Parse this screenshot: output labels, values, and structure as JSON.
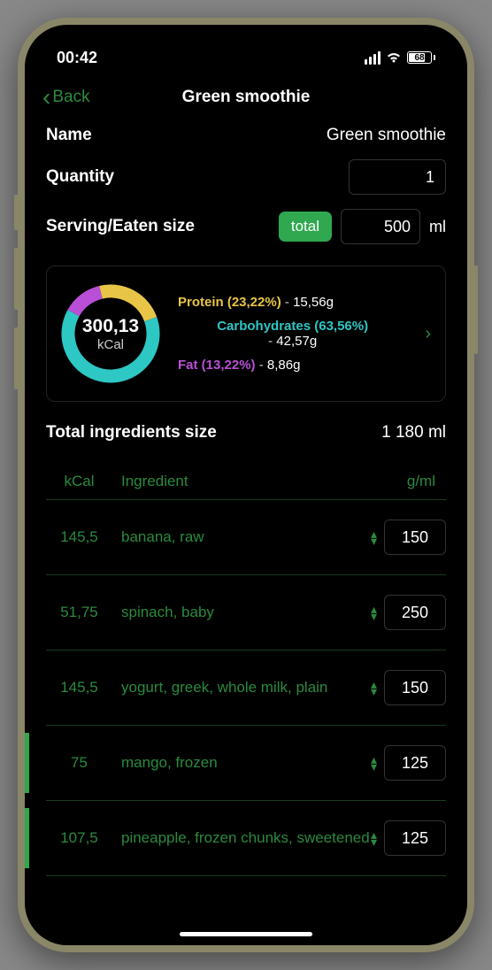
{
  "status": {
    "time": "00:42",
    "battery": "68"
  },
  "nav": {
    "back_label": "Back",
    "title": "Green smoothie"
  },
  "fields": {
    "name_label": "Name",
    "name_value": "Green smoothie",
    "quantity_label": "Quantity",
    "quantity_value": "1",
    "serving_label": "Serving/Eaten size",
    "serving_badge": "total",
    "serving_value": "500",
    "serving_unit": "ml"
  },
  "macros": {
    "kcal": "300,13",
    "kcal_label": "kCal",
    "protein_label": "Protein (23,22%)",
    "protein_grams": "15,56g",
    "carbs_label": "Carbohydrates (63,56%)",
    "carbs_grams": "42,57g",
    "fat_label": "Fat (13,22%)",
    "fat_grams": "8,86g"
  },
  "total_ingredients": {
    "label": "Total ingredients size",
    "value": "1 180 ml"
  },
  "table_headers": {
    "kcal": "kCal",
    "ingredient": "Ingredient",
    "gml": "g/ml"
  },
  "ingredients": [
    {
      "kcal": "145,5",
      "name": "banana, raw",
      "amount": "150",
      "highlighted": false
    },
    {
      "kcal": "51,75",
      "name": "spinach, baby",
      "amount": "250",
      "highlighted": false
    },
    {
      "kcal": "145,5",
      "name": "yogurt, greek, whole milk, plain",
      "amount": "150",
      "highlighted": false
    },
    {
      "kcal": "75",
      "name": "mango, frozen",
      "amount": "125",
      "highlighted": true
    },
    {
      "kcal": "107,5",
      "name": "pineapple, frozen chunks, sweetened",
      "amount": "125",
      "highlighted": true
    }
  ],
  "chart_data": {
    "type": "pie",
    "title": "Macronutrient breakdown",
    "series": [
      {
        "name": "Protein",
        "value": 23.22,
        "grams": 15.56,
        "color": "#e8c547"
      },
      {
        "name": "Carbohydrates",
        "value": 63.56,
        "grams": 42.57,
        "color": "#2dc7c4"
      },
      {
        "name": "Fat",
        "value": 13.22,
        "grams": 8.86,
        "color": "#b94fd6"
      }
    ],
    "center_value": 300.13,
    "center_unit": "kCal"
  }
}
